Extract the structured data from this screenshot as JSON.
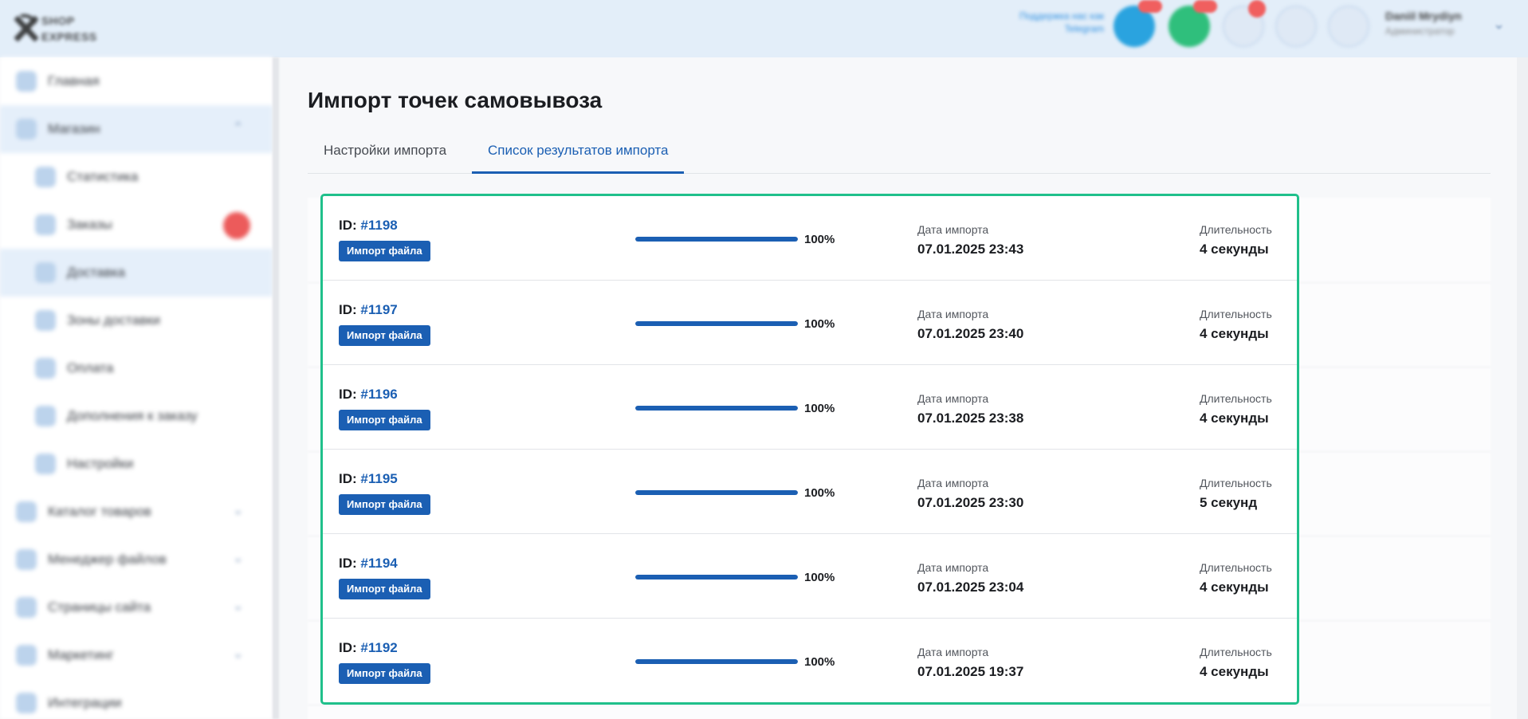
{
  "header": {
    "logo_top": "SHOP",
    "logo_bottom": "EXPRESS",
    "support_line1": "Поддержка нас как",
    "support_line2": "Telegram",
    "telegram_badge": "",
    "whatsapp_badge": "",
    "notif_badge": "",
    "user_name": "Daniil Mrydiyn",
    "user_role": "Администратор",
    "colors": {
      "bg": "#e3eef9",
      "telegram": "#2aa3df",
      "whatsapp": "#2fbf7c",
      "badge": "#f05f5f"
    }
  },
  "sidebar": {
    "items": [
      {
        "label": "Главная",
        "icon": "home-icon"
      },
      {
        "label": "Магазин",
        "icon": "cart-icon",
        "expanded": true
      },
      {
        "label": "Статистика",
        "icon": "chart-icon"
      },
      {
        "label": "Заказы",
        "icon": "orders-icon",
        "badge": ""
      },
      {
        "label": "Доставка",
        "icon": "delivery-icon"
      },
      {
        "label": "Зоны доставки",
        "icon": "map-pin-icon"
      },
      {
        "label": "Оплата",
        "icon": "wallet-icon"
      },
      {
        "label": "Дополнения к заказу",
        "icon": "plus-circle-icon"
      },
      {
        "label": "Настройки",
        "icon": "gear-icon"
      },
      {
        "label": "Каталог товаров",
        "icon": "catalog-icon"
      },
      {
        "label": "Менеджер файлов",
        "icon": "folder-icon"
      },
      {
        "label": "Страницы сайта",
        "icon": "pages-icon"
      },
      {
        "label": "Маркетинг",
        "icon": "megaphone-icon"
      },
      {
        "label": "Интеграции",
        "icon": "plug-icon"
      }
    ]
  },
  "main": {
    "title": "Импорт точек самовывоза",
    "tabs": [
      {
        "label": "Настройки импорта",
        "active": false
      },
      {
        "label": "Список результатов импорта",
        "active": true
      }
    ],
    "accent_color": "#1b5fb3",
    "highlight_color": "#20c08b",
    "results": [
      {
        "id_label": "ID:",
        "id": "#1198",
        "type": "Импорт файла",
        "progress": 1.0,
        "percent": "100%",
        "date_label": "Дата импорта",
        "date": "07.01.2025 23:43",
        "duration_label": "Длительность",
        "duration": "4 секунды"
      },
      {
        "id_label": "ID:",
        "id": "#1197",
        "type": "Импорт файла",
        "progress": 1.0,
        "percent": "100%",
        "date_label": "Дата импорта",
        "date": "07.01.2025 23:40",
        "duration_label": "Длительность",
        "duration": "4 секунды"
      },
      {
        "id_label": "ID:",
        "id": "#1196",
        "type": "Импорт файла",
        "progress": 1.0,
        "percent": "100%",
        "date_label": "Дата импорта",
        "date": "07.01.2025 23:38",
        "duration_label": "Длительность",
        "duration": "4 секунды"
      },
      {
        "id_label": "ID:",
        "id": "#1195",
        "type": "Импорт файла",
        "progress": 1.0,
        "percent": "100%",
        "date_label": "Дата импорта",
        "date": "07.01.2025 23:30",
        "duration_label": "Длительность",
        "duration": "5 секунд"
      },
      {
        "id_label": "ID:",
        "id": "#1194",
        "type": "Импорт файла",
        "progress": 1.0,
        "percent": "100%",
        "date_label": "Дата импорта",
        "date": "07.01.2025 23:04",
        "duration_label": "Длительность",
        "duration": "4 секунды"
      },
      {
        "id_label": "ID:",
        "id": "#1192",
        "type": "Импорт файла",
        "progress": 1.0,
        "percent": "100%",
        "date_label": "Дата импорта",
        "date": "07.01.2025 19:37",
        "duration_label": "Длительность",
        "duration": "4 секунды"
      }
    ]
  }
}
